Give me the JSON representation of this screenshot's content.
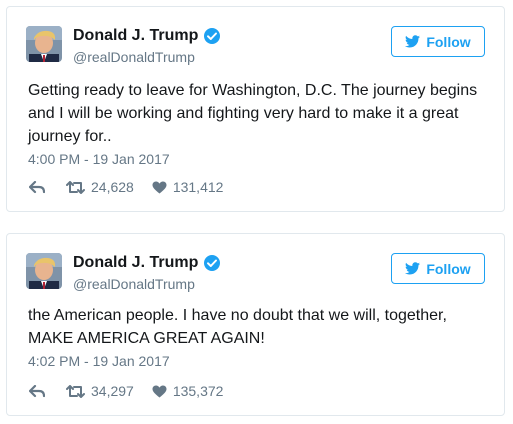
{
  "accent_color": "#1da1f2",
  "tweets": [
    {
      "user": {
        "name": "Donald J. Trump",
        "handle": "@realDonaldTrump",
        "verified": true
      },
      "follow_label": "Follow",
      "text": "Getting ready to leave for Washington, D.C. The journey begins and I will be working and fighting very hard to make it a great journey for..",
      "timestamp": "4:00 PM - 19 Jan 2017",
      "retweets": "24,628",
      "likes": "131,412"
    },
    {
      "user": {
        "name": "Donald J. Trump",
        "handle": "@realDonaldTrump",
        "verified": true
      },
      "follow_label": "Follow",
      "text": "the American people. I have no doubt that we will, together, MAKE AMERICA GREAT AGAIN!",
      "timestamp": "4:02 PM - 19 Jan 2017",
      "retweets": "34,297",
      "likes": "135,372"
    }
  ],
  "icons": {
    "avatar": "profile-photo",
    "verified": "verified-badge-icon",
    "follow": "twitter-bird-icon",
    "reply": "reply-icon",
    "retweet": "retweet-icon",
    "like": "heart-icon"
  }
}
